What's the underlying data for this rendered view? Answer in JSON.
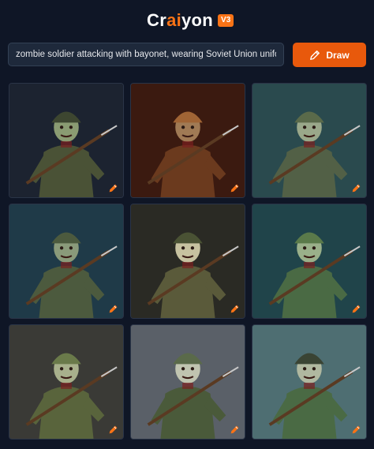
{
  "app": {
    "logo_prefix": "Cr",
    "logo_accent": "ai",
    "logo_suffix": "yon",
    "version_badge": "V3",
    "accent_color": "#f97316"
  },
  "search": {
    "prompt_value": "zombie soldier attacking with bayonet, wearing Soviet Union uniform",
    "draw_label": "Draw",
    "draw_icon": "pencil-icon"
  },
  "results": {
    "count": 9,
    "items": [
      {
        "bg": "#1c2330",
        "skin": "#8a9b72",
        "uniform": "#4a5236",
        "helmet": "#3d4630"
      },
      {
        "bg": "#3b1a10",
        "skin": "#a07a55",
        "uniform": "#6b3a1e",
        "helmet": "#a06435"
      },
      {
        "bg": "#2a4a4e",
        "skin": "#9aa88a",
        "uniform": "#526046",
        "helmet": "#5a6a4a"
      },
      {
        "bg": "#1f3a48",
        "skin": "#8a9a7a",
        "uniform": "#4c5a3e",
        "helmet": "#4c5a3e"
      },
      {
        "bg": "#2a2a24",
        "skin": "#c7c2a0",
        "uniform": "#5a5a3a",
        "helmet": "#4a5234"
      },
      {
        "bg": "#20444a",
        "skin": "#9ab08a",
        "uniform": "#4a6a44",
        "helmet": "#5a7a4a"
      },
      {
        "bg": "#3a3a36",
        "skin": "#a8b08c",
        "uniform": "#59643c",
        "helmet": "#6a7a4a"
      },
      {
        "bg": "#5a6068",
        "skin": "#c0c4b0",
        "uniform": "#4a5a3a",
        "helmet": "#5a6a4a"
      },
      {
        "bg": "#4e6e72",
        "skin": "#b0b8a0",
        "uniform": "#4a6a44",
        "helmet": "#3a4434"
      }
    ]
  }
}
